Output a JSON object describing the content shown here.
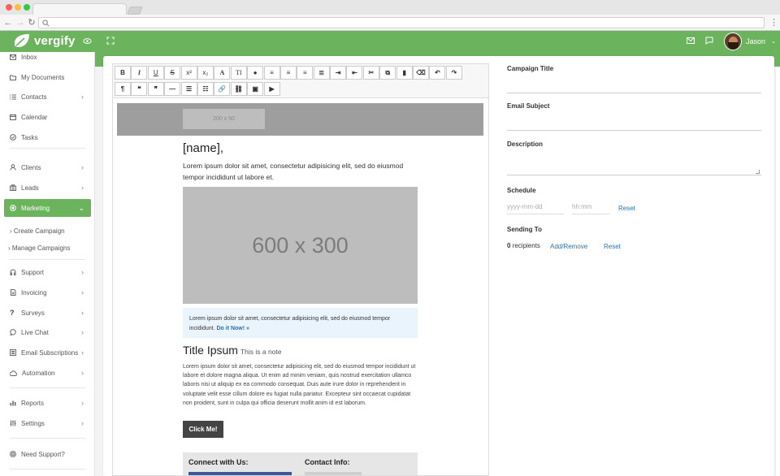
{
  "app": {
    "brand": "vergify",
    "user_name": "Jason",
    "accent_color": "#6bb35d"
  },
  "sidebar": {
    "items": [
      {
        "label": "Inbox",
        "icon": "mail-icon"
      },
      {
        "label": "My Documents",
        "icon": "folder-icon"
      },
      {
        "label": "Contacts",
        "icon": "list-icon"
      },
      {
        "label": "Calendar",
        "icon": "calendar-icon"
      },
      {
        "label": "Tasks",
        "icon": "check-circle-icon"
      },
      {
        "label": "Clients",
        "icon": "user-icon"
      },
      {
        "label": "Leads",
        "icon": "briefcase-icon"
      },
      {
        "label": "Marketing",
        "icon": "target-icon"
      },
      {
        "label": "Support",
        "icon": "support-icon"
      },
      {
        "label": "Invoicing",
        "icon": "invoice-icon"
      },
      {
        "label": "Surveys",
        "icon": "question-icon"
      },
      {
        "label": "Live Chat",
        "icon": "chat-icon"
      },
      {
        "label": "Email Subscriptions",
        "icon": "newsletter-icon"
      },
      {
        "label": "Automation",
        "icon": "cloud-icon"
      },
      {
        "label": "Reports",
        "icon": "bar-chart-icon"
      },
      {
        "label": "Settings",
        "icon": "sliders-icon"
      },
      {
        "label": "Need Support?",
        "icon": "help-icon"
      }
    ],
    "sub_items": [
      "Create Campaign",
      "Manage Campaigns"
    ]
  },
  "editor": {
    "logo_placeholder": "200 x 50",
    "greeting": "[name],",
    "paragraph1": "Lorem ipsum dolor sit amet, consectetur adipisicing elit, sed do eiusmod tempor incididunt ut labore et.",
    "hero_placeholder": "600 x 300",
    "callout_text": "Lorem ipsum dolor sit amet, consectetur adipisicing elit, sed do eiusmod tempor incididunt.",
    "callout_link": "Do it Now! »",
    "title2": "Title Ipsum",
    "note": "This is a note",
    "paragraph2": "Lorem ipsum dolor sit amet, consectetur adipisicing elit, sed do eiusmod tempor incididunt ut labore et dolore magna aliqua. Ut enim ad minim veniam, quis nostrud exercitation ullamco laboris nisi ut aliquip ex ea commodo consequat. Duis aute irure dolor in reprehenderit in voluptate velit esse cillum dolore eu fugiat nulla pariatur. Excepteur sint occaecat cupidatat non proident, sunt in culpa qui officia deserunt mollit anim id est laborum.",
    "cta": "Click Me!",
    "footer_connect": "Connect with Us:",
    "footer_contact": "Contact Info:"
  },
  "form": {
    "campaign_title_label": "Campaign Title",
    "email_subject_label": "Email Subject",
    "description_label": "Description",
    "schedule_label": "Schedule",
    "date_placeholder": "yyyy-mm-dd",
    "time_placeholder": "hh:mm",
    "reset_label": "Reset",
    "sending_to_label": "Sending To",
    "recipients_count": "0",
    "recipients_label": "recipients",
    "add_remove_label": "Add/Remove"
  }
}
